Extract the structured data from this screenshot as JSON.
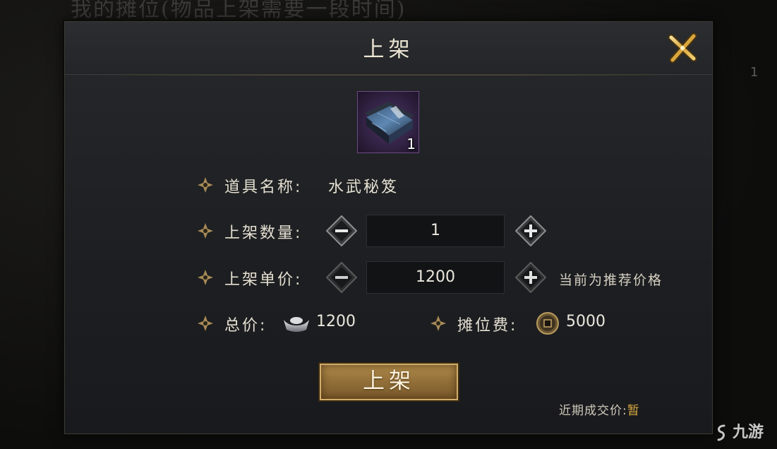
{
  "background": {
    "title": "我的摊位(物品上架需要一段时间)",
    "count": "1"
  },
  "dialog": {
    "title": "上架",
    "close_icon": "close-x-icon"
  },
  "item": {
    "icon": "martial-manual-book-icon",
    "quantity_badge": "1",
    "rarity_color": "#6b4a85"
  },
  "form": {
    "name_label": "道具名称:",
    "name_value": "水武秘笈",
    "quantity_label": "上架数量:",
    "quantity_value": "1",
    "price_label": "上架单价:",
    "price_value": "1200",
    "price_hint": "当前为推荐价格",
    "total_label": "总价:",
    "total_value": "1200",
    "total_currency_icon": "silver-ingot-icon",
    "fee_label": "摊位费:",
    "fee_value": "5000",
    "fee_currency_icon": "copper-coin-icon"
  },
  "confirm_button": {
    "label": "上架"
  },
  "recent_price": {
    "label": "近期成交价:",
    "value": "暂"
  },
  "watermark": {
    "text": "九游"
  },
  "colors": {
    "accent_gold": "#b18c4c",
    "panel": "#1d1f22",
    "highlight": "#d9a940"
  }
}
